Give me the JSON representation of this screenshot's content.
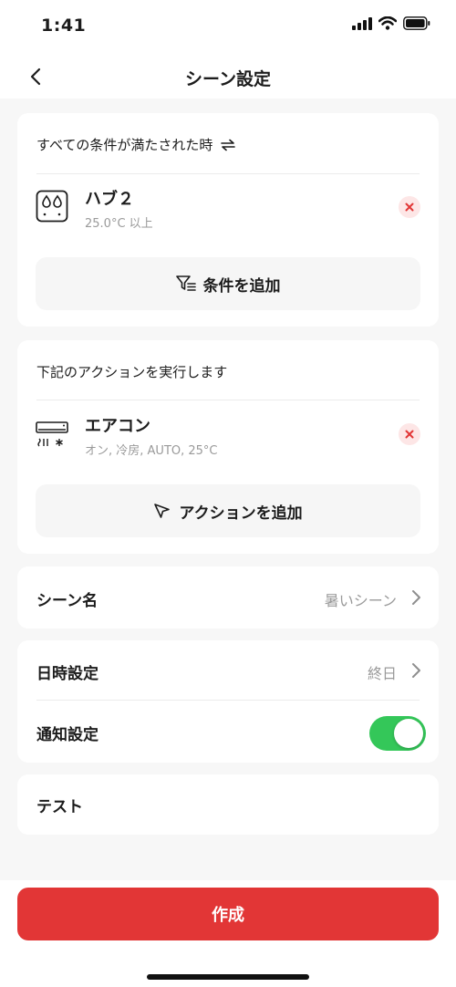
{
  "status_bar": {
    "time": "1:41"
  },
  "header": {
    "title": "シーン設定"
  },
  "conditions": {
    "heading": "すべての条件が満たされた時",
    "items": [
      {
        "name": "ハブ２",
        "detail": "25.0°C 以上",
        "icon": "hub-humidity-icon"
      }
    ],
    "add_label": "条件を追加"
  },
  "actions": {
    "heading": "下記のアクションを実行します",
    "items": [
      {
        "name": "エアコン",
        "detail": "オン, 冷房, AUTO, 25°C",
        "icon": "air-conditioner-icon"
      }
    ],
    "add_label": "アクションを追加"
  },
  "scene_name": {
    "label": "シーン名",
    "value": "暑いシーン"
  },
  "schedule": {
    "label": "日時設定",
    "value": "終日"
  },
  "notification": {
    "label": "通知設定",
    "enabled": true
  },
  "test": {
    "label": "テスト"
  },
  "footer": {
    "create_label": "作成"
  },
  "colors": {
    "accent": "#e23636",
    "toggle_on": "#34c759",
    "remove_bg": "#fde6e6"
  }
}
